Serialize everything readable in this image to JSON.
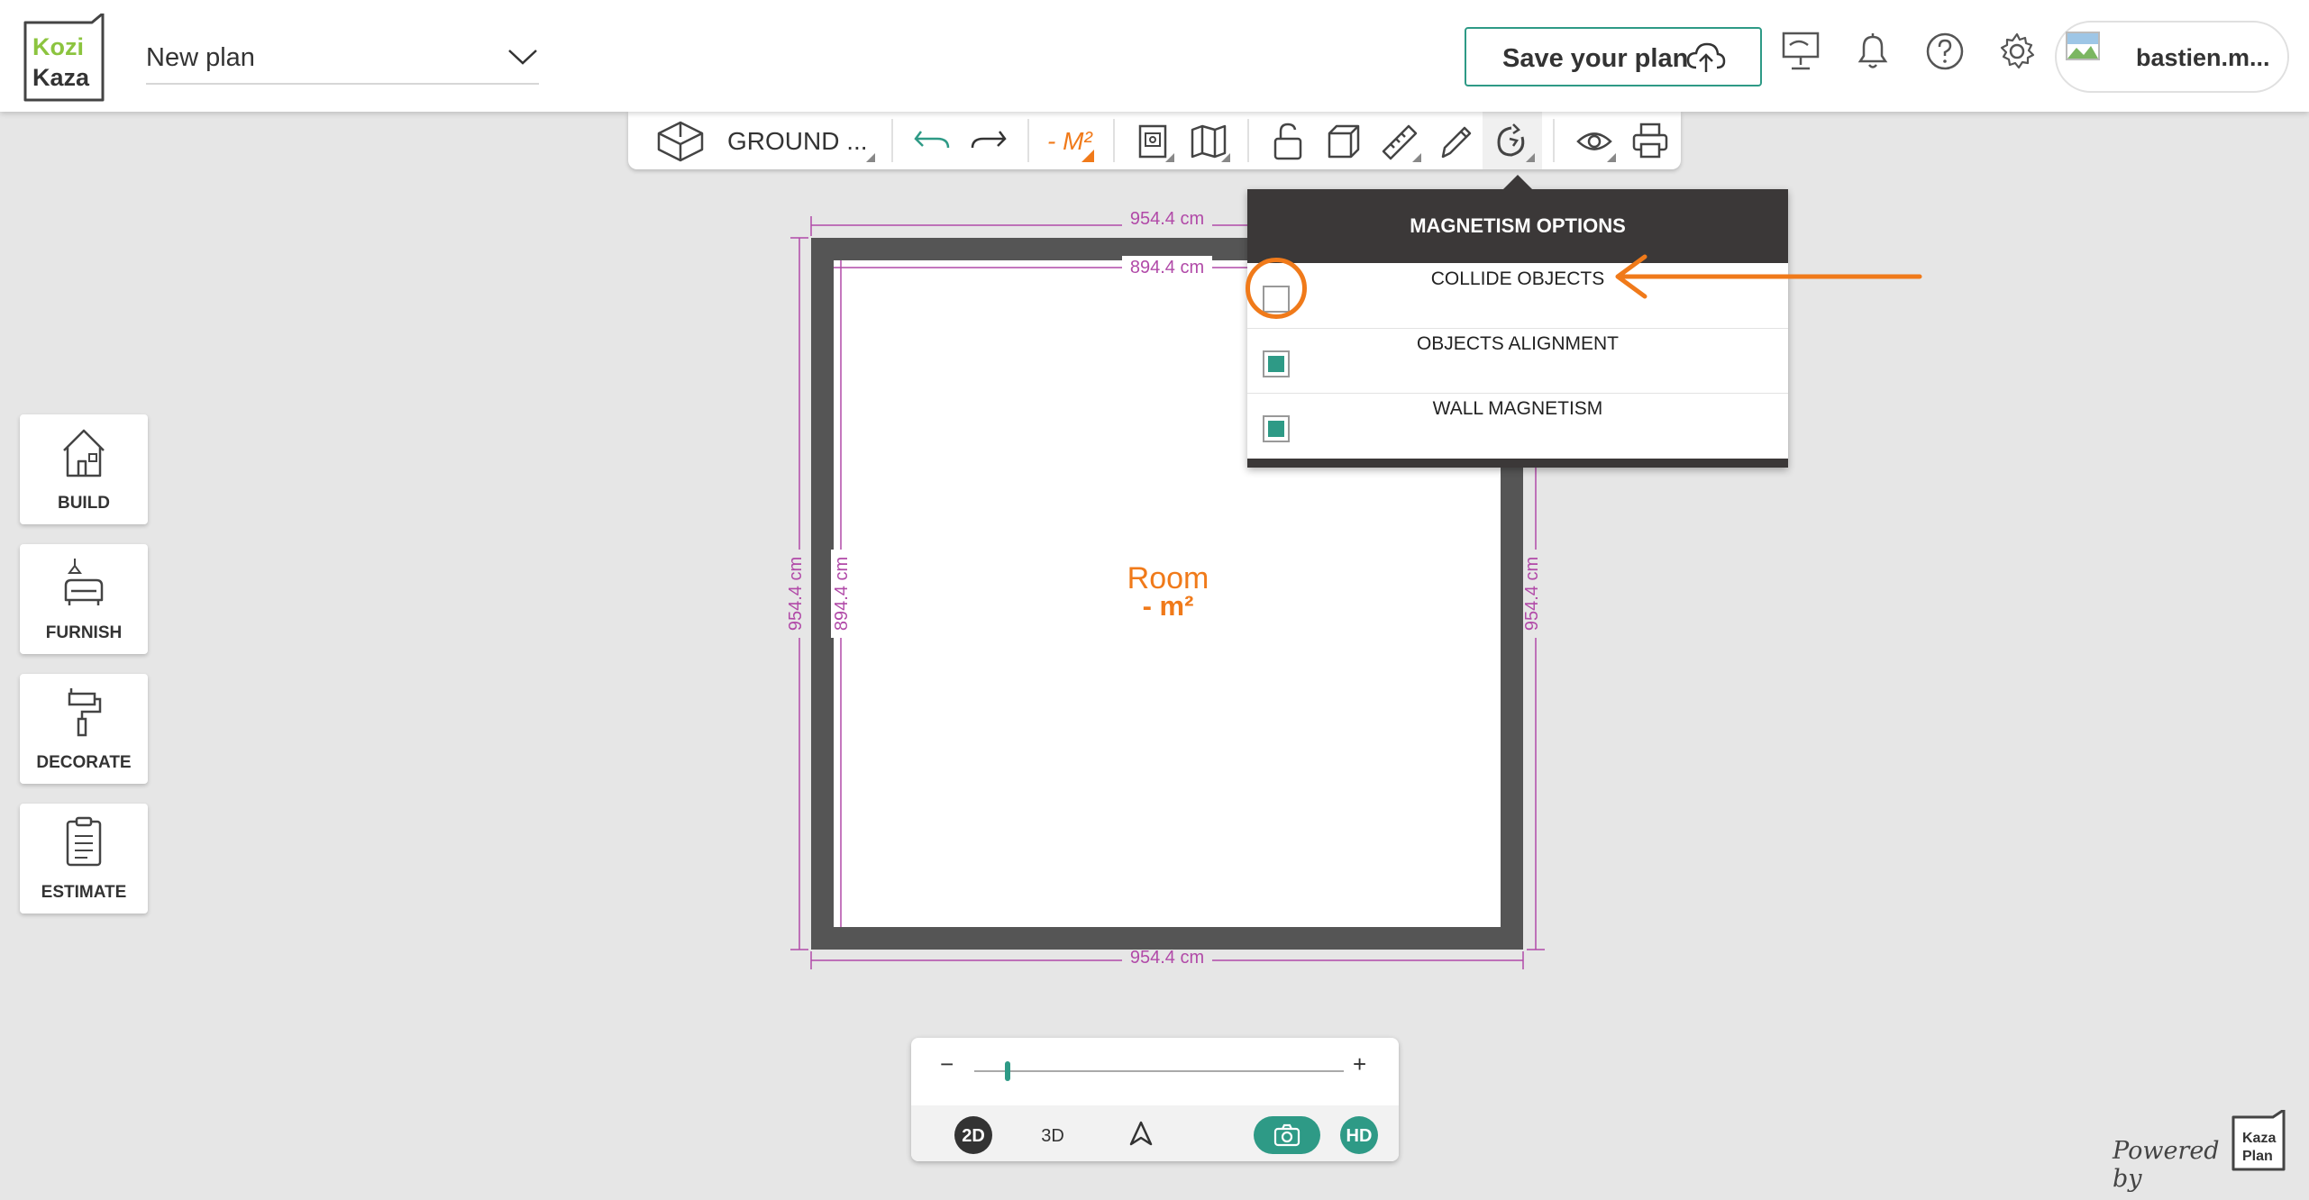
{
  "header": {
    "logo_top": "Kozi",
    "logo_bottom": "Kaza",
    "plan_name": "New plan",
    "save_label": "Save your plan",
    "user_name": "bastien.m..."
  },
  "toolbar": {
    "level_label": "GROUND ...",
    "area_label": "- M²"
  },
  "sidebar": {
    "items": [
      {
        "label": "BUILD",
        "icon": "house-icon"
      },
      {
        "label": "FURNISH",
        "icon": "sofa-icon"
      },
      {
        "label": "DECORATE",
        "icon": "paint-roller-icon"
      },
      {
        "label": "ESTIMATE",
        "icon": "clipboard-icon"
      }
    ]
  },
  "plan": {
    "room_name": "Room",
    "room_area": "- m²",
    "dim_top_outer": "954.4 cm",
    "dim_top_inner": "894.4 cm",
    "dim_left_outer": "954.4 cm",
    "dim_left_inner": "894.4 cm",
    "dim_right_outer": "954.4 cm",
    "dim_bottom_outer": "954.4 cm"
  },
  "magnetism": {
    "title": "MAGNETISM OPTIONS",
    "options": [
      {
        "label": "COLLIDE OBJECTS",
        "checked": false
      },
      {
        "label": "OBJECTS ALIGNMENT",
        "checked": true
      },
      {
        "label": "WALL MAGNETISM",
        "checked": true
      }
    ]
  },
  "view": {
    "zoom_minus": "−",
    "zoom_plus": "+",
    "zoom_level": 0.09,
    "mode_2d": "2D",
    "mode_3d": "3D",
    "hd_label": "HD",
    "active_mode": "2D"
  },
  "footer": {
    "powered_by": "Powered by",
    "brand_top": "Kaza",
    "brand_bottom": "Plan"
  },
  "colors": {
    "accent": "#2e9a86",
    "orange": "#f07a1a",
    "dimension": "#b14aa8",
    "wall": "#555555"
  }
}
